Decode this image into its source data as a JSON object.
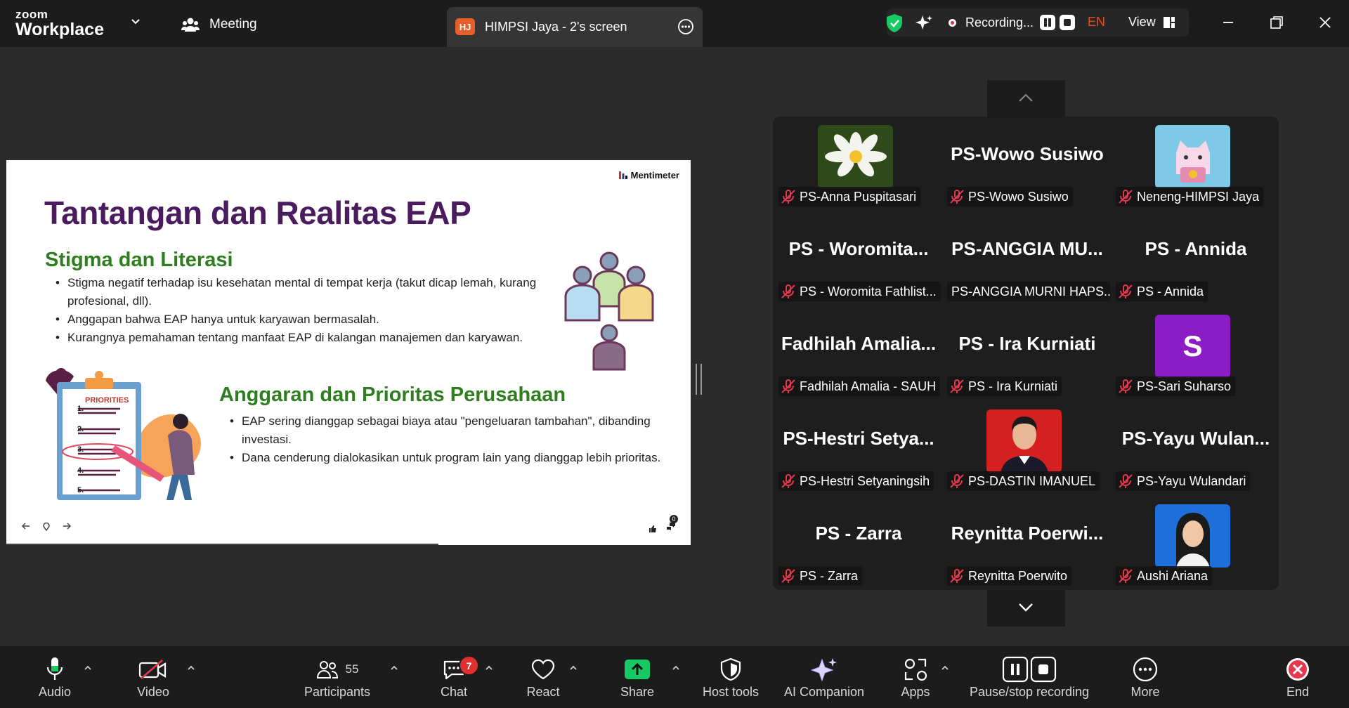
{
  "app": {
    "brand_top": "zoom",
    "brand_bottom": "Workplace"
  },
  "topbar": {
    "meeting_label": "Meeting",
    "share_tab": {
      "initials": "HJ",
      "title": "HIMPSI Jaya - 2's screen"
    },
    "recording_label": "Recording...",
    "language": "EN",
    "view_label": "View"
  },
  "slide": {
    "brand": "Mentimeter",
    "title": "Tantangan dan Realitas EAP",
    "section1": {
      "heading": "Stigma dan Literasi",
      "bullets": [
        "Stigma negatif terhadap isu kesehatan mental di tempat kerja (takut dicap lemah, kurang profesional, dll).",
        "Anggapan bahwa EAP hanya untuk karyawan bermasalah.",
        "Kurangnya pemahaman tentang manfaat EAP di kalangan manajemen dan karyawan."
      ]
    },
    "section2": {
      "heading": "Anggaran dan Prioritas Perusahaan",
      "bullets": [
        "EAP sering dianggap sebagai biaya atau \"pengeluaran tambahan\", dibanding investasi.",
        "Dana cenderung dialokasikan untuk program lain yang dianggap lebih prioritas."
      ]
    },
    "clipboard_label": "PRIORITIES",
    "list_numbers": [
      "1.",
      "2.",
      "3.",
      "4.",
      "5."
    ],
    "reaction_count": "0"
  },
  "participants": [
    {
      "display": "",
      "name": "PS-Anna Puspitasari",
      "photo": "flower"
    },
    {
      "display": "PS-Wowo Susiwo",
      "name": "PS-Wowo Susiwo"
    },
    {
      "display": "",
      "name": "Neneng-HIMPSI Jaya",
      "photo": "cat"
    },
    {
      "display": "PS  - Woromita...",
      "name": "PS - Woromita Fathlist..."
    },
    {
      "display": "PS-ANGGIA  MU...",
      "name": "PS-ANGGIA MURNI HAPS...",
      "unmuted": true
    },
    {
      "display": "PS  - Annida",
      "name": "PS - Annida"
    },
    {
      "display": "Fadhilah  Amalia...",
      "name": "Fadhilah Amalia - SAUH"
    },
    {
      "display": "PS  - Ira Kurniati",
      "name": "PS - Ira Kurniati"
    },
    {
      "display": "S",
      "name": "PS-Sari Suharso",
      "photo": "letter"
    },
    {
      "display": "PS-Hestri  Setya...",
      "name": "PS-Hestri Setyaningsih"
    },
    {
      "display": "",
      "name": "PS-DASTIN IMANUEL",
      "photo": "man"
    },
    {
      "display": "PS-Yayu  Wulan...",
      "name": "PS-Yayu Wulandari"
    },
    {
      "display": "PS  - Zarra",
      "name": "PS - Zarra"
    },
    {
      "display": "Reynitta  Poerwi...",
      "name": "Reynitta Poerwito"
    },
    {
      "display": "",
      "name": "Aushi Ariana",
      "photo": "woman"
    }
  ],
  "toolbar": {
    "audio": "Audio",
    "video": "Video",
    "participants": "Participants",
    "participants_count": "55",
    "chat": "Chat",
    "chat_badge": "7",
    "react": "React",
    "share": "Share",
    "host_tools": "Host tools",
    "ai_companion": "AI Companion",
    "apps": "Apps",
    "pause_stop": "Pause/stop recording",
    "more": "More",
    "end": "End"
  },
  "colors": {
    "accent_green": "#17c964",
    "record_red": "#e0254c",
    "slide_title": "#4a1c5e",
    "slide_heading": "#2e7d1e",
    "end_red": "#e5384f"
  }
}
